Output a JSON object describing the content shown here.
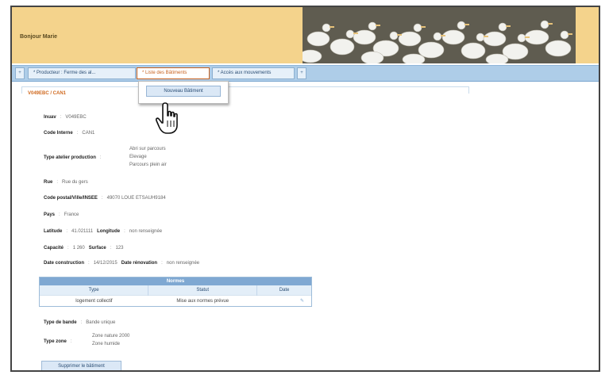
{
  "header": {
    "greeting": "Bonjour Marie"
  },
  "tabs": [
    {
      "label": "+"
    },
    {
      "label": "* Producteur : Ferme des al..."
    },
    {
      "label": "* Liste des Bâtiments"
    },
    {
      "label": "* Accès aux mouvements"
    },
    {
      "label": "+"
    }
  ],
  "dropdown": {
    "item": "Nouveau Bâtiment"
  },
  "panel": {
    "title": "V049EBC / CAN1"
  },
  "fields": {
    "inuav_label": "Inuav",
    "inuav_value": "V049EBC",
    "code_label": "Code Interne",
    "code_value": "CAN1",
    "type_label": "Type atelier production",
    "type_values": [
      "Abri sur parcours",
      "Elevage",
      "Parcours plein air"
    ],
    "rue_label": "Rue",
    "rue_value": "Rue du gers",
    "cp_label": "Code postal/Ville/INSEE",
    "cp_value": "49070 LOUE ETSAUH9184",
    "pays_label": "Pays",
    "pays_value": "France",
    "lat_label": "Latitude",
    "lat_value": "41.021111",
    "lon_label": "Longitude",
    "lon_value": "non renseignée",
    "cap_label": "Capacité",
    "cap_value": "1 260",
    "surf_label": "Surface",
    "surf_value": "123",
    "dc_label": "Date construction",
    "dc_value": "14/12/2015",
    "dr_label": "Date rénovation",
    "dr_value": "non renseignée",
    "bande_label": "Type de bande",
    "bande_value": "Bande unique",
    "zone_label": "Type zone",
    "zone_values": [
      "Zone nature 2000",
      "Zone humide"
    ]
  },
  "normes": {
    "title": "Normes",
    "headers": [
      "Type",
      "Statut",
      "Date"
    ],
    "row": [
      "logement collectif",
      "Mise aux normes prévue",
      ""
    ]
  },
  "actions": {
    "delete": "Supprimer le bâtiment"
  }
}
